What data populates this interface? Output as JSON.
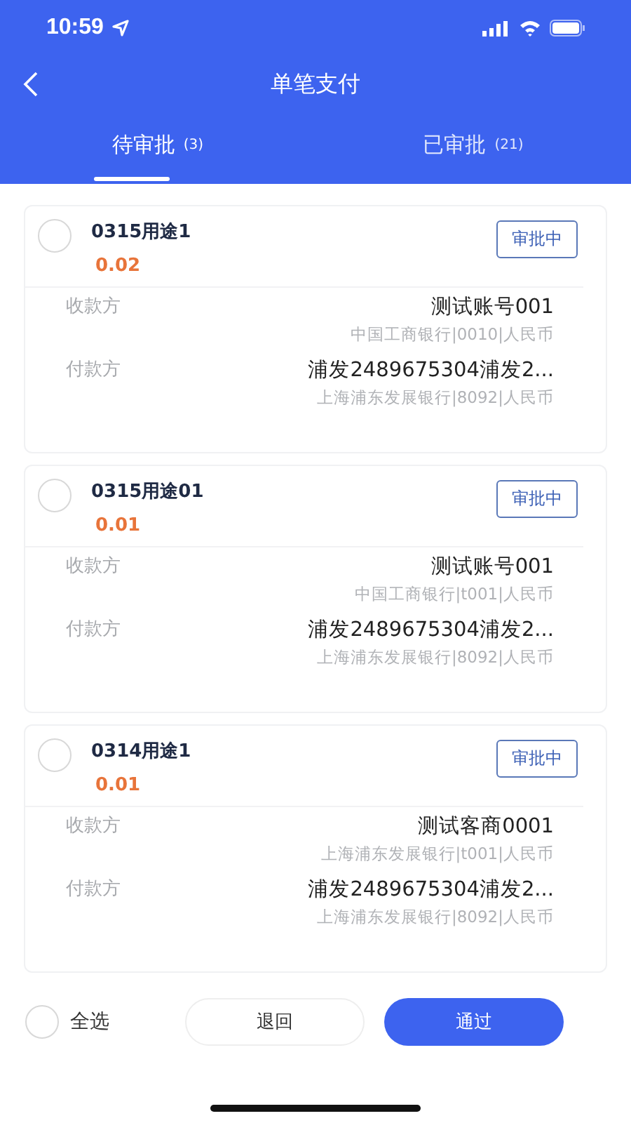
{
  "status_bar": {
    "time": "10:59"
  },
  "nav": {
    "title": "单笔支付"
  },
  "tabs": [
    {
      "label": "待审批",
      "count": "(3)",
      "selected": true
    },
    {
      "label": "已审批",
      "count": "(21)",
      "selected": false
    }
  ],
  "payments": [
    {
      "title": "0315用途1",
      "amount": "0.02",
      "status": "审批中",
      "checked": false,
      "payee_label": "收款方",
      "payee": "测试账号001",
      "payee_bank": "中国工商银行|0010|人民币",
      "payer_label": "付款方",
      "payer": "浦发2489675304浦发2...",
      "payer_bank": "上海浦东发展银行|8092|人民币"
    },
    {
      "title": "0315用途01",
      "amount": "0.01",
      "status": "审批中",
      "checked": false,
      "payee_label": "收款方",
      "payee": "测试账号001",
      "payee_bank": "中国工商银行|t001|人民币",
      "payer_label": "付款方",
      "payer": "浦发2489675304浦发2...",
      "payer_bank": "上海浦东发展银行|8092|人民币"
    },
    {
      "title": "0314用途1",
      "amount": "0.01",
      "status": "审批中",
      "checked": false,
      "payee_label": "收款方",
      "payee": "测试客商0001",
      "payee_bank": "上海浦东发展银行|t001|人民币",
      "payer_label": "付款方",
      "payer": "浦发2489675304浦发2...",
      "payer_bank": "上海浦东发展银行|8092|人民币"
    }
  ],
  "footer": {
    "select_all": {
      "label": "全选",
      "checked": false
    },
    "reject": "退回",
    "approve": "通过"
  }
}
